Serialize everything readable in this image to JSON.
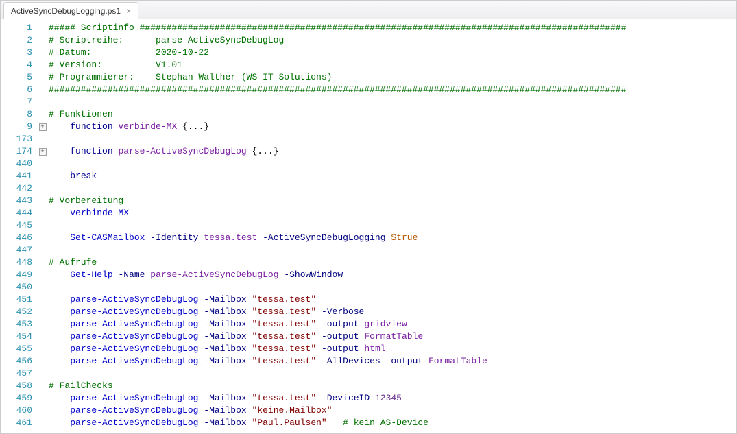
{
  "tab": {
    "title": "ActiveSyncDebugLogging.ps1",
    "close_label": "×"
  },
  "lines": [
    {
      "num": "1",
      "fold": "",
      "tokens": [
        {
          "c": "c-comment",
          "t": "##### Scriptinfo ###########################################################################################"
        }
      ]
    },
    {
      "num": "2",
      "fold": "",
      "tokens": [
        {
          "c": "c-comment",
          "t": "# Scriptreihe:      parse-ActiveSyncDebugLog"
        }
      ]
    },
    {
      "num": "3",
      "fold": "",
      "tokens": [
        {
          "c": "c-comment",
          "t": "# Datum:            2020-10-22"
        }
      ]
    },
    {
      "num": "4",
      "fold": "",
      "tokens": [
        {
          "c": "c-comment",
          "t": "# Version:          V1.01"
        }
      ]
    },
    {
      "num": "5",
      "fold": "",
      "tokens": [
        {
          "c": "c-comment",
          "t": "# Programmierer:    Stephan Walther (WS IT-Solutions)"
        }
      ]
    },
    {
      "num": "6",
      "fold": "",
      "tokens": [
        {
          "c": "c-comment",
          "t": "############################################################################################################"
        }
      ]
    },
    {
      "num": "7",
      "fold": "",
      "tokens": [
        {
          "c": "",
          "t": ""
        }
      ]
    },
    {
      "num": "8",
      "fold": "",
      "tokens": [
        {
          "c": "c-comment",
          "t": "# Funktionen"
        }
      ]
    },
    {
      "num": "9",
      "fold": "+",
      "tokens": [
        {
          "c": "",
          "t": "    "
        },
        {
          "c": "c-keyword",
          "t": "function"
        },
        {
          "c": "",
          "t": " "
        },
        {
          "c": "c-func",
          "t": "verbinde-MX"
        },
        {
          "c": "",
          "t": " {...}"
        }
      ]
    },
    {
      "num": "173",
      "fold": "",
      "tokens": [
        {
          "c": "",
          "t": ""
        }
      ]
    },
    {
      "num": "174",
      "fold": "+",
      "tokens": [
        {
          "c": "",
          "t": "    "
        },
        {
          "c": "c-keyword",
          "t": "function"
        },
        {
          "c": "",
          "t": " "
        },
        {
          "c": "c-func",
          "t": "parse-ActiveSyncDebugLog"
        },
        {
          "c": "",
          "t": " {...}"
        }
      ]
    },
    {
      "num": "440",
      "fold": "",
      "tokens": [
        {
          "c": "",
          "t": ""
        }
      ]
    },
    {
      "num": "441",
      "fold": "",
      "tokens": [
        {
          "c": "",
          "t": "    "
        },
        {
          "c": "c-keyword",
          "t": "break"
        }
      ]
    },
    {
      "num": "442",
      "fold": "",
      "tokens": [
        {
          "c": "",
          "t": ""
        }
      ]
    },
    {
      "num": "443",
      "fold": "",
      "tokens": [
        {
          "c": "c-comment",
          "t": "# Vorbereitung"
        }
      ]
    },
    {
      "num": "444",
      "fold": "",
      "tokens": [
        {
          "c": "",
          "t": "    "
        },
        {
          "c": "c-cmdlet",
          "t": "verbinde-MX"
        }
      ]
    },
    {
      "num": "445",
      "fold": "",
      "tokens": [
        {
          "c": "",
          "t": ""
        }
      ]
    },
    {
      "num": "446",
      "fold": "",
      "tokens": [
        {
          "c": "",
          "t": "    "
        },
        {
          "c": "c-cmdlet",
          "t": "Set-CASMailbox"
        },
        {
          "c": "",
          "t": " "
        },
        {
          "c": "c-param",
          "t": "-Identity"
        },
        {
          "c": "",
          "t": " "
        },
        {
          "c": "c-func",
          "t": "tessa.test"
        },
        {
          "c": "",
          "t": " "
        },
        {
          "c": "c-param",
          "t": "-ActiveSyncDebugLogging"
        },
        {
          "c": "",
          "t": " "
        },
        {
          "c": "c-var",
          "t": "$true"
        }
      ]
    },
    {
      "num": "447",
      "fold": "",
      "tokens": [
        {
          "c": "",
          "t": ""
        }
      ]
    },
    {
      "num": "448",
      "fold": "",
      "tokens": [
        {
          "c": "c-comment",
          "t": "# Aufrufe"
        }
      ]
    },
    {
      "num": "449",
      "fold": "",
      "tokens": [
        {
          "c": "",
          "t": "    "
        },
        {
          "c": "c-cmdlet",
          "t": "Get-Help"
        },
        {
          "c": "",
          "t": " "
        },
        {
          "c": "c-param",
          "t": "-Name"
        },
        {
          "c": "",
          "t": " "
        },
        {
          "c": "c-func",
          "t": "parse-ActiveSyncDebugLog"
        },
        {
          "c": "",
          "t": " "
        },
        {
          "c": "c-param",
          "t": "-ShowWindow"
        }
      ]
    },
    {
      "num": "450",
      "fold": "",
      "tokens": [
        {
          "c": "",
          "t": ""
        }
      ]
    },
    {
      "num": "451",
      "fold": "",
      "tokens": [
        {
          "c": "",
          "t": "    "
        },
        {
          "c": "c-cmdlet",
          "t": "parse-ActiveSyncDebugLog"
        },
        {
          "c": "",
          "t": " "
        },
        {
          "c": "c-param",
          "t": "-Mailbox"
        },
        {
          "c": "",
          "t": " "
        },
        {
          "c": "c-string",
          "t": "\"tessa.test\""
        }
      ]
    },
    {
      "num": "452",
      "fold": "",
      "tokens": [
        {
          "c": "",
          "t": "    "
        },
        {
          "c": "c-cmdlet",
          "t": "parse-ActiveSyncDebugLog"
        },
        {
          "c": "",
          "t": " "
        },
        {
          "c": "c-param",
          "t": "-Mailbox"
        },
        {
          "c": "",
          "t": " "
        },
        {
          "c": "c-string",
          "t": "\"tessa.test\""
        },
        {
          "c": "",
          "t": " "
        },
        {
          "c": "c-param",
          "t": "-Verbose"
        }
      ]
    },
    {
      "num": "453",
      "fold": "",
      "tokens": [
        {
          "c": "",
          "t": "    "
        },
        {
          "c": "c-cmdlet",
          "t": "parse-ActiveSyncDebugLog"
        },
        {
          "c": "",
          "t": " "
        },
        {
          "c": "c-param",
          "t": "-Mailbox"
        },
        {
          "c": "",
          "t": " "
        },
        {
          "c": "c-string",
          "t": "\"tessa.test\""
        },
        {
          "c": "",
          "t": " "
        },
        {
          "c": "c-param",
          "t": "-output"
        },
        {
          "c": "",
          "t": " "
        },
        {
          "c": "c-func",
          "t": "gridview"
        }
      ]
    },
    {
      "num": "454",
      "fold": "",
      "tokens": [
        {
          "c": "",
          "t": "    "
        },
        {
          "c": "c-cmdlet",
          "t": "parse-ActiveSyncDebugLog"
        },
        {
          "c": "",
          "t": " "
        },
        {
          "c": "c-param",
          "t": "-Mailbox"
        },
        {
          "c": "",
          "t": " "
        },
        {
          "c": "c-string",
          "t": "\"tessa.test\""
        },
        {
          "c": "",
          "t": " "
        },
        {
          "c": "c-param",
          "t": "-output"
        },
        {
          "c": "",
          "t": " "
        },
        {
          "c": "c-func",
          "t": "FormatTable"
        }
      ]
    },
    {
      "num": "455",
      "fold": "",
      "tokens": [
        {
          "c": "",
          "t": "    "
        },
        {
          "c": "c-cmdlet",
          "t": "parse-ActiveSyncDebugLog"
        },
        {
          "c": "",
          "t": " "
        },
        {
          "c": "c-param",
          "t": "-Mailbox"
        },
        {
          "c": "",
          "t": " "
        },
        {
          "c": "c-string",
          "t": "\"tessa.test\""
        },
        {
          "c": "",
          "t": " "
        },
        {
          "c": "c-param",
          "t": "-output"
        },
        {
          "c": "",
          "t": " "
        },
        {
          "c": "c-func",
          "t": "html"
        }
      ]
    },
    {
      "num": "456",
      "fold": "",
      "tokens": [
        {
          "c": "",
          "t": "    "
        },
        {
          "c": "c-cmdlet",
          "t": "parse-ActiveSyncDebugLog"
        },
        {
          "c": "",
          "t": " "
        },
        {
          "c": "c-param",
          "t": "-Mailbox"
        },
        {
          "c": "",
          "t": " "
        },
        {
          "c": "c-string",
          "t": "\"tessa.test\""
        },
        {
          "c": "",
          "t": " "
        },
        {
          "c": "c-param",
          "t": "-AllDevices"
        },
        {
          "c": "",
          "t": " "
        },
        {
          "c": "c-param",
          "t": "-output"
        },
        {
          "c": "",
          "t": " "
        },
        {
          "c": "c-func",
          "t": "FormatTable"
        }
      ]
    },
    {
      "num": "457",
      "fold": "",
      "tokens": [
        {
          "c": "",
          "t": ""
        }
      ]
    },
    {
      "num": "458",
      "fold": "",
      "tokens": [
        {
          "c": "c-comment",
          "t": "# FailChecks"
        }
      ]
    },
    {
      "num": "459",
      "fold": "",
      "tokens": [
        {
          "c": "",
          "t": "    "
        },
        {
          "c": "c-cmdlet",
          "t": "parse-ActiveSyncDebugLog"
        },
        {
          "c": "",
          "t": " "
        },
        {
          "c": "c-param",
          "t": "-Mailbox"
        },
        {
          "c": "",
          "t": " "
        },
        {
          "c": "c-string",
          "t": "\"tessa.test\""
        },
        {
          "c": "",
          "t": " "
        },
        {
          "c": "c-param",
          "t": "-DeviceID"
        },
        {
          "c": "",
          "t": " "
        },
        {
          "c": "c-number",
          "t": "12345"
        }
      ]
    },
    {
      "num": "460",
      "fold": "",
      "tokens": [
        {
          "c": "",
          "t": "    "
        },
        {
          "c": "c-cmdlet",
          "t": "parse-ActiveSyncDebugLog"
        },
        {
          "c": "",
          "t": " "
        },
        {
          "c": "c-param",
          "t": "-Mailbox"
        },
        {
          "c": "",
          "t": " "
        },
        {
          "c": "c-string",
          "t": "\"keine.Mailbox\""
        }
      ]
    },
    {
      "num": "461",
      "fold": "",
      "tokens": [
        {
          "c": "",
          "t": "    "
        },
        {
          "c": "c-cmdlet",
          "t": "parse-ActiveSyncDebugLog"
        },
        {
          "c": "",
          "t": " "
        },
        {
          "c": "c-param",
          "t": "-Mailbox"
        },
        {
          "c": "",
          "t": " "
        },
        {
          "c": "c-string",
          "t": "\"Paul.Paulsen\""
        },
        {
          "c": "",
          "t": "   "
        },
        {
          "c": "c-comment",
          "t": "# kein AS-Device"
        }
      ]
    }
  ]
}
